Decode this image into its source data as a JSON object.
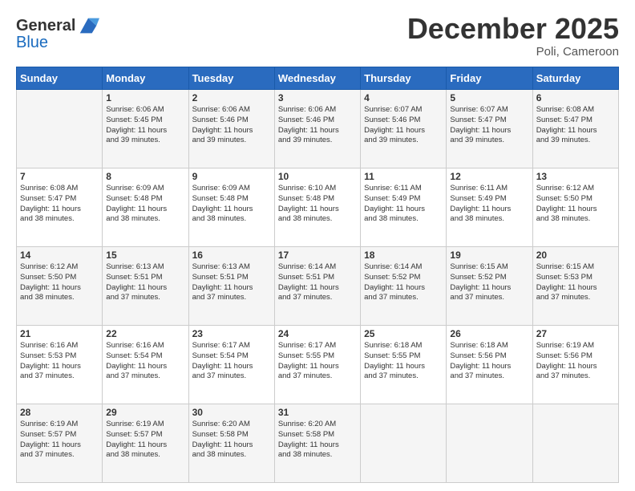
{
  "header": {
    "logo_general": "General",
    "logo_blue": "Blue",
    "month_title": "December 2025",
    "location": "Poli, Cameroon"
  },
  "weekdays": [
    "Sunday",
    "Monday",
    "Tuesday",
    "Wednesday",
    "Thursday",
    "Friday",
    "Saturday"
  ],
  "weeks": [
    [
      {
        "day": "",
        "info": ""
      },
      {
        "day": "1",
        "info": "Sunrise: 6:06 AM\nSunset: 5:45 PM\nDaylight: 11 hours\nand 39 minutes."
      },
      {
        "day": "2",
        "info": "Sunrise: 6:06 AM\nSunset: 5:46 PM\nDaylight: 11 hours\nand 39 minutes."
      },
      {
        "day": "3",
        "info": "Sunrise: 6:06 AM\nSunset: 5:46 PM\nDaylight: 11 hours\nand 39 minutes."
      },
      {
        "day": "4",
        "info": "Sunrise: 6:07 AM\nSunset: 5:46 PM\nDaylight: 11 hours\nand 39 minutes."
      },
      {
        "day": "5",
        "info": "Sunrise: 6:07 AM\nSunset: 5:47 PM\nDaylight: 11 hours\nand 39 minutes."
      },
      {
        "day": "6",
        "info": "Sunrise: 6:08 AM\nSunset: 5:47 PM\nDaylight: 11 hours\nand 39 minutes."
      }
    ],
    [
      {
        "day": "7",
        "info": "Sunrise: 6:08 AM\nSunset: 5:47 PM\nDaylight: 11 hours\nand 38 minutes."
      },
      {
        "day": "8",
        "info": "Sunrise: 6:09 AM\nSunset: 5:48 PM\nDaylight: 11 hours\nand 38 minutes."
      },
      {
        "day": "9",
        "info": "Sunrise: 6:09 AM\nSunset: 5:48 PM\nDaylight: 11 hours\nand 38 minutes."
      },
      {
        "day": "10",
        "info": "Sunrise: 6:10 AM\nSunset: 5:48 PM\nDaylight: 11 hours\nand 38 minutes."
      },
      {
        "day": "11",
        "info": "Sunrise: 6:11 AM\nSunset: 5:49 PM\nDaylight: 11 hours\nand 38 minutes."
      },
      {
        "day": "12",
        "info": "Sunrise: 6:11 AM\nSunset: 5:49 PM\nDaylight: 11 hours\nand 38 minutes."
      },
      {
        "day": "13",
        "info": "Sunrise: 6:12 AM\nSunset: 5:50 PM\nDaylight: 11 hours\nand 38 minutes."
      }
    ],
    [
      {
        "day": "14",
        "info": "Sunrise: 6:12 AM\nSunset: 5:50 PM\nDaylight: 11 hours\nand 38 minutes."
      },
      {
        "day": "15",
        "info": "Sunrise: 6:13 AM\nSunset: 5:51 PM\nDaylight: 11 hours\nand 37 minutes."
      },
      {
        "day": "16",
        "info": "Sunrise: 6:13 AM\nSunset: 5:51 PM\nDaylight: 11 hours\nand 37 minutes."
      },
      {
        "day": "17",
        "info": "Sunrise: 6:14 AM\nSunset: 5:51 PM\nDaylight: 11 hours\nand 37 minutes."
      },
      {
        "day": "18",
        "info": "Sunrise: 6:14 AM\nSunset: 5:52 PM\nDaylight: 11 hours\nand 37 minutes."
      },
      {
        "day": "19",
        "info": "Sunrise: 6:15 AM\nSunset: 5:52 PM\nDaylight: 11 hours\nand 37 minutes."
      },
      {
        "day": "20",
        "info": "Sunrise: 6:15 AM\nSunset: 5:53 PM\nDaylight: 11 hours\nand 37 minutes."
      }
    ],
    [
      {
        "day": "21",
        "info": "Sunrise: 6:16 AM\nSunset: 5:53 PM\nDaylight: 11 hours\nand 37 minutes."
      },
      {
        "day": "22",
        "info": "Sunrise: 6:16 AM\nSunset: 5:54 PM\nDaylight: 11 hours\nand 37 minutes."
      },
      {
        "day": "23",
        "info": "Sunrise: 6:17 AM\nSunset: 5:54 PM\nDaylight: 11 hours\nand 37 minutes."
      },
      {
        "day": "24",
        "info": "Sunrise: 6:17 AM\nSunset: 5:55 PM\nDaylight: 11 hours\nand 37 minutes."
      },
      {
        "day": "25",
        "info": "Sunrise: 6:18 AM\nSunset: 5:55 PM\nDaylight: 11 hours\nand 37 minutes."
      },
      {
        "day": "26",
        "info": "Sunrise: 6:18 AM\nSunset: 5:56 PM\nDaylight: 11 hours\nand 37 minutes."
      },
      {
        "day": "27",
        "info": "Sunrise: 6:19 AM\nSunset: 5:56 PM\nDaylight: 11 hours\nand 37 minutes."
      }
    ],
    [
      {
        "day": "28",
        "info": "Sunrise: 6:19 AM\nSunset: 5:57 PM\nDaylight: 11 hours\nand 37 minutes."
      },
      {
        "day": "29",
        "info": "Sunrise: 6:19 AM\nSunset: 5:57 PM\nDaylight: 11 hours\nand 38 minutes."
      },
      {
        "day": "30",
        "info": "Sunrise: 6:20 AM\nSunset: 5:58 PM\nDaylight: 11 hours\nand 38 minutes."
      },
      {
        "day": "31",
        "info": "Sunrise: 6:20 AM\nSunset: 5:58 PM\nDaylight: 11 hours\nand 38 minutes."
      },
      {
        "day": "",
        "info": ""
      },
      {
        "day": "",
        "info": ""
      },
      {
        "day": "",
        "info": ""
      }
    ]
  ]
}
